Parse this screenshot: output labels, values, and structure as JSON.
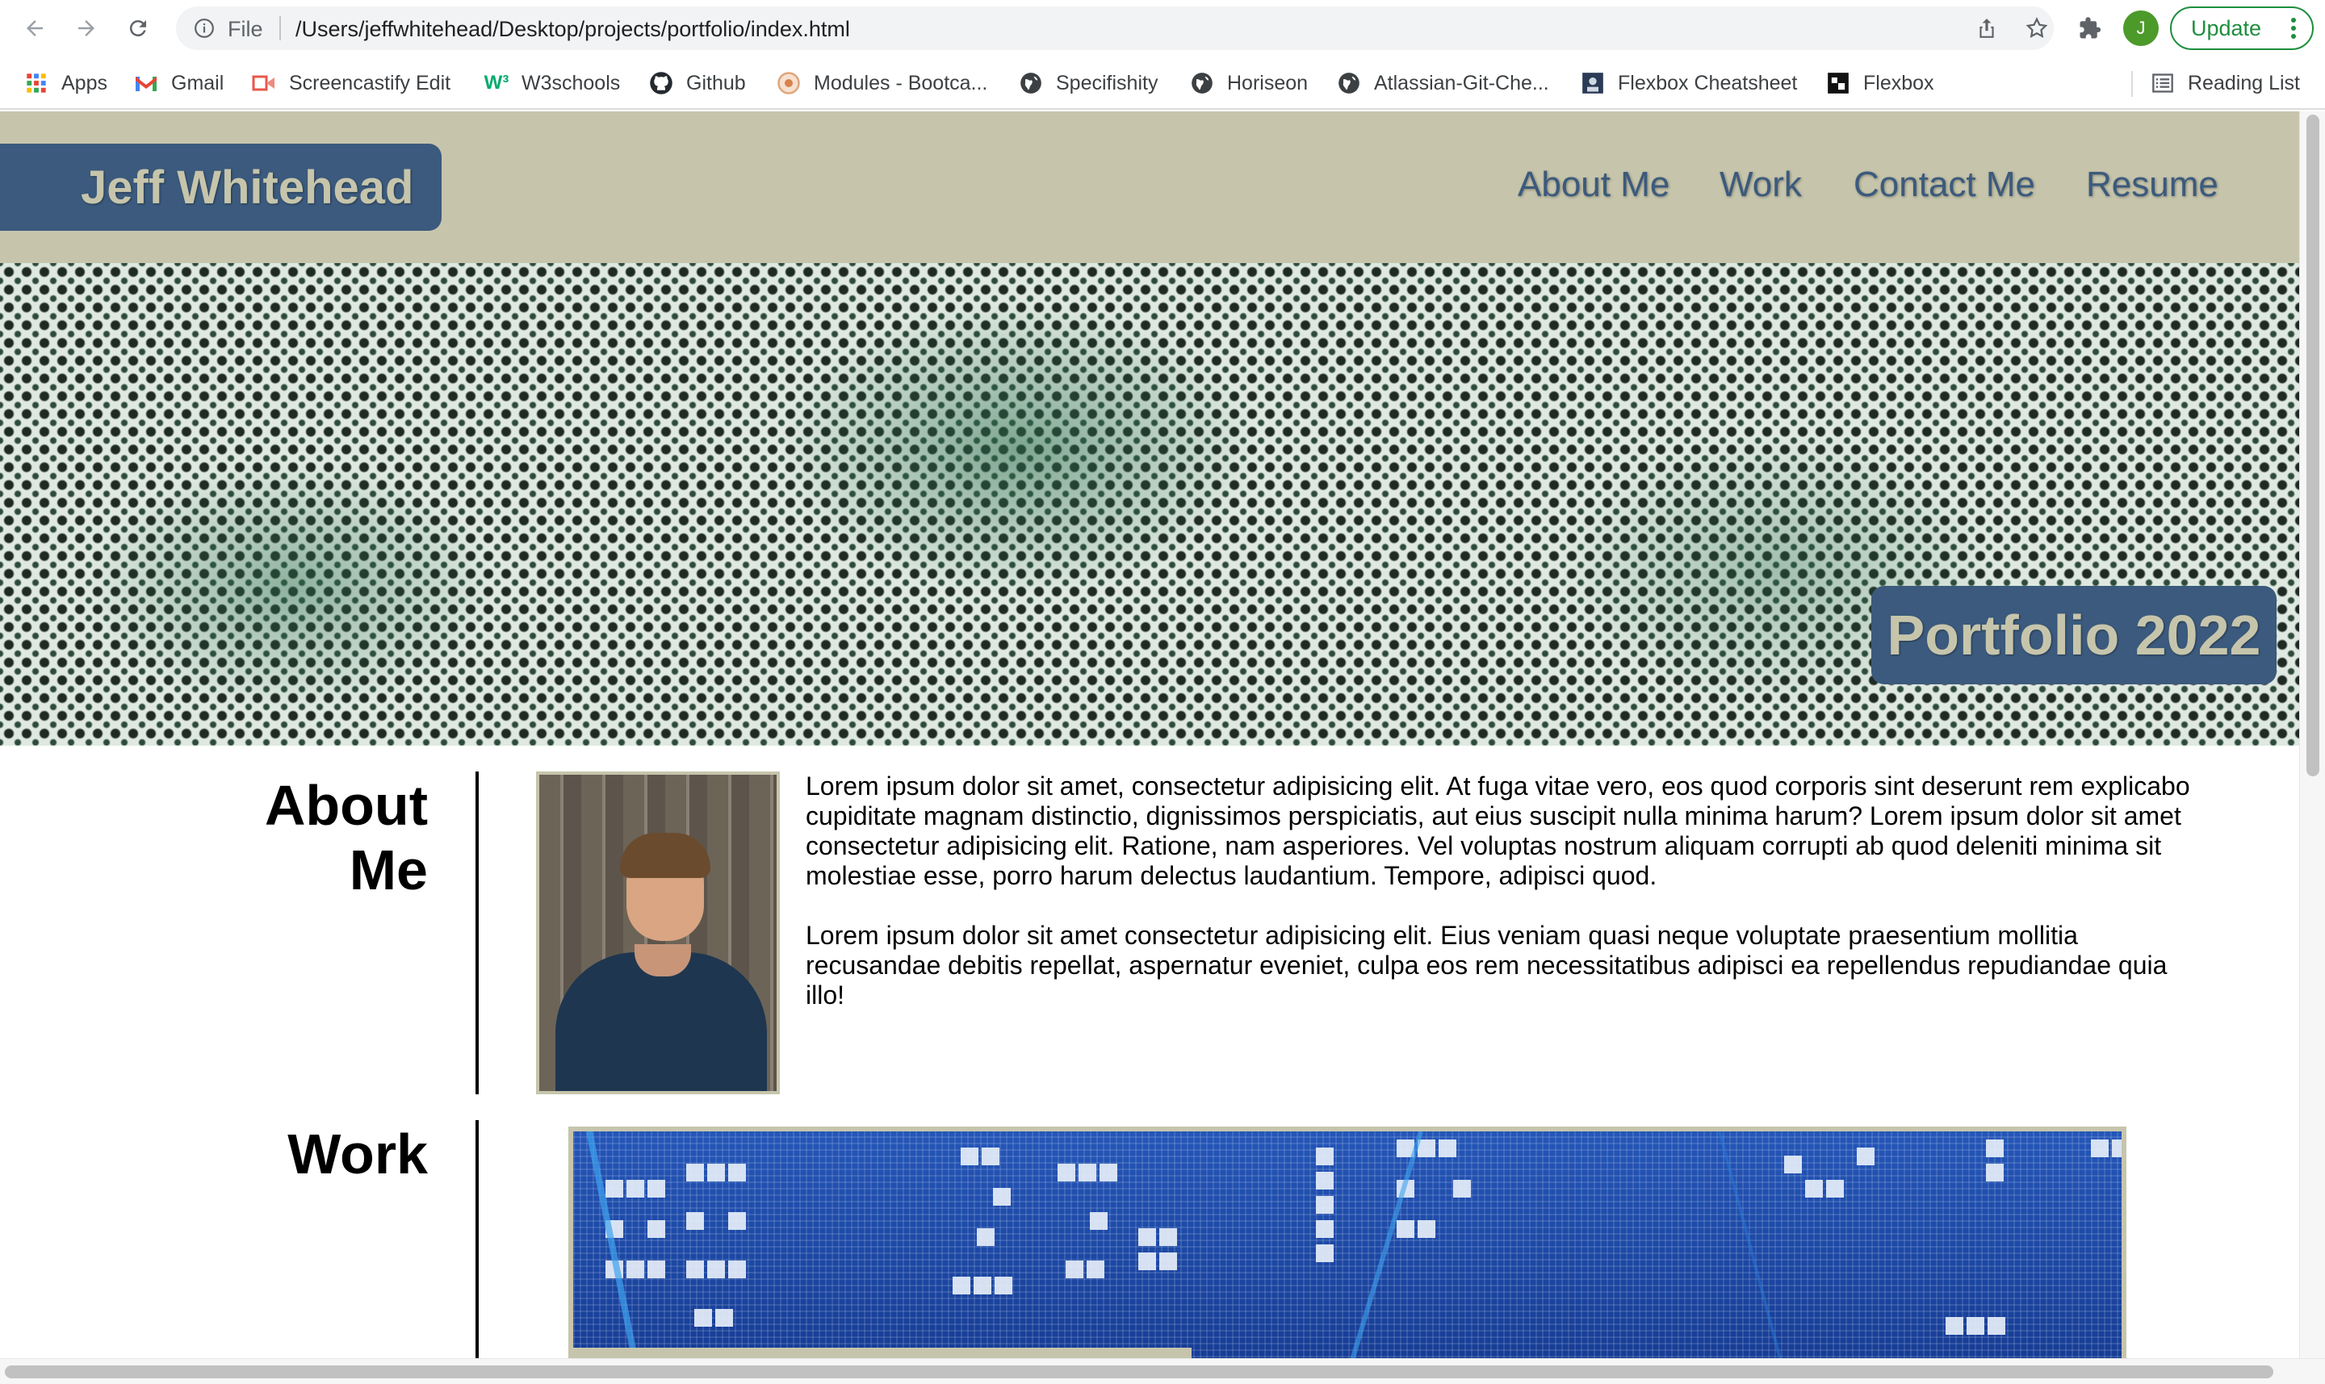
{
  "browser": {
    "scheme_label": "File",
    "url": "/Users/jeffwhitehead/Desktop/projects/portfolio/index.html",
    "update_label": "Update",
    "profile_initial": "J",
    "bookmarks": [
      {
        "label": "Apps",
        "icon": "apps-grid-icon"
      },
      {
        "label": "Gmail",
        "icon": "gmail-icon"
      },
      {
        "label": "Screencastify Edit",
        "icon": "screencastify-icon"
      },
      {
        "label": "W3schools",
        "icon": "w3schools-icon"
      },
      {
        "label": "Github",
        "icon": "github-icon"
      },
      {
        "label": "Modules - Bootca...",
        "icon": "bootcamp-icon"
      },
      {
        "label": "Specifishity",
        "icon": "globe-icon"
      },
      {
        "label": "Horiseon",
        "icon": "globe-icon"
      },
      {
        "label": "Atlassian-Git-Che...",
        "icon": "globe-icon"
      },
      {
        "label": "Flexbox Cheatsheet",
        "icon": "flexbox-icon"
      },
      {
        "label": "Flexbox",
        "icon": "flexbox-icon"
      }
    ],
    "reading_list_label": "Reading List"
  },
  "site": {
    "brand": "Jeff Whitehead",
    "nav": [
      "About Me",
      "Work",
      "Contact Me",
      "Resume"
    ],
    "hero_tag": "Portfolio 2022",
    "about": {
      "title_line1": "About",
      "title_line2": "Me",
      "paragraph1": "Lorem ipsum dolor sit amet, consectetur adipisicing elit. At fuga vitae vero, eos quod corporis sint deserunt rem explicabo cupiditate magnam distinctio, dignissimos perspiciatis, aut eius suscipit nulla minima harum? Lorem ipsum dolor sit amet consectetur adipisicing elit. Ratione, nam asperiores. Vel voluptas nostrum aliquam corrupti ab quod deleniti minima sit molestiae esse, porro harum delectus laudantium. Tempore, adipisci quod.",
      "paragraph2": "Lorem ipsum dolor sit amet consectetur adipisicing elit. Eius veniam quasi neque voluptate praesentium mollitia recusandae debitis repellat, aspernatur eveniet, culpa eos rem necessitatibus adipisci ea repellendus repudiandae quia illo!"
    },
    "work": {
      "title": "Work"
    }
  },
  "colors": {
    "header_bg": "#c6c5ac",
    "accent_blue": "#3b5a7d",
    "update_green": "#1e8e3e"
  }
}
